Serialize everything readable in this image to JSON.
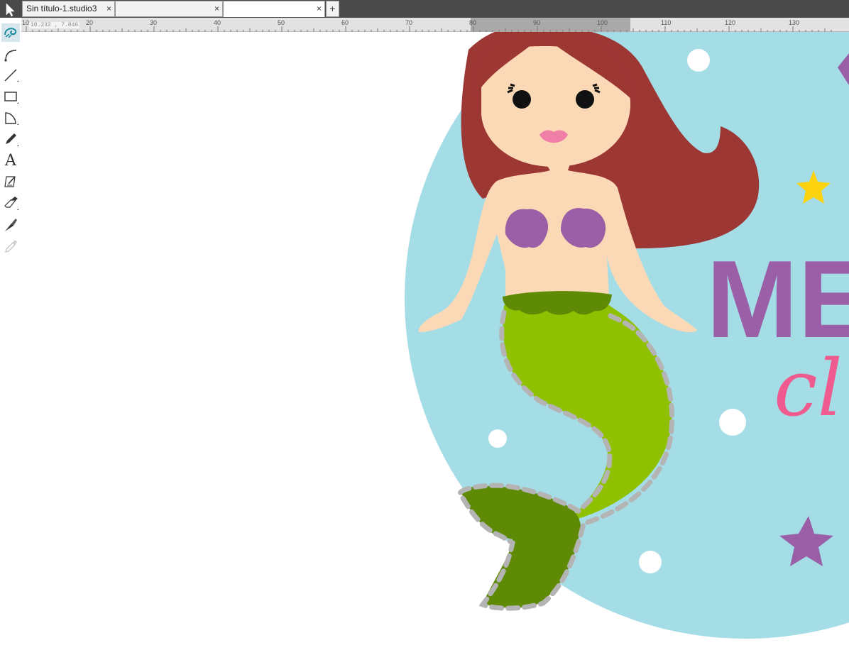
{
  "tabs": [
    {
      "label": "Sin título-1.studio3",
      "close": "×"
    },
    {
      "label": "",
      "close": "×"
    },
    {
      "label": "",
      "close": "×"
    }
  ],
  "tab_add": "+",
  "coordinate_readout": "10.232 , 7.846",
  "ruler": {
    "labels": [
      "10",
      "20",
      "30",
      "40",
      "50",
      "60",
      "70",
      "80",
      "90",
      "100",
      "110",
      "120",
      "130"
    ],
    "selection_range": [
      80,
      105
    ]
  },
  "toolbar": {
    "tools": [
      "select-icon",
      "pixscan-icon",
      "bezier-icon",
      "line-icon",
      "rectangle-icon",
      "polygon-icon",
      "pencil-icon",
      "text-icon",
      "edit-text-icon",
      "eraser-icon",
      "knife-icon",
      "eyedropper-icon"
    ],
    "text_tool_glyph": "A",
    "active_tool": "pixscan-icon"
  },
  "artwork": {
    "title_text": "MER",
    "subtitle_text": "cl",
    "colors": {
      "background_circle": "#a5dde7",
      "hair": "#9c3734",
      "skin": "#fcd9b6",
      "shell": "#9a5fa7",
      "tail": "#8fc100",
      "tail_dark": "#5f8a06",
      "star_yellow": "#fdd20f",
      "star_purple": "#9a5fa7",
      "title_purple": "#9a5fa7",
      "subtitle_pink": "#ef5b8e",
      "cut_line": "#b4b4b4"
    }
  }
}
